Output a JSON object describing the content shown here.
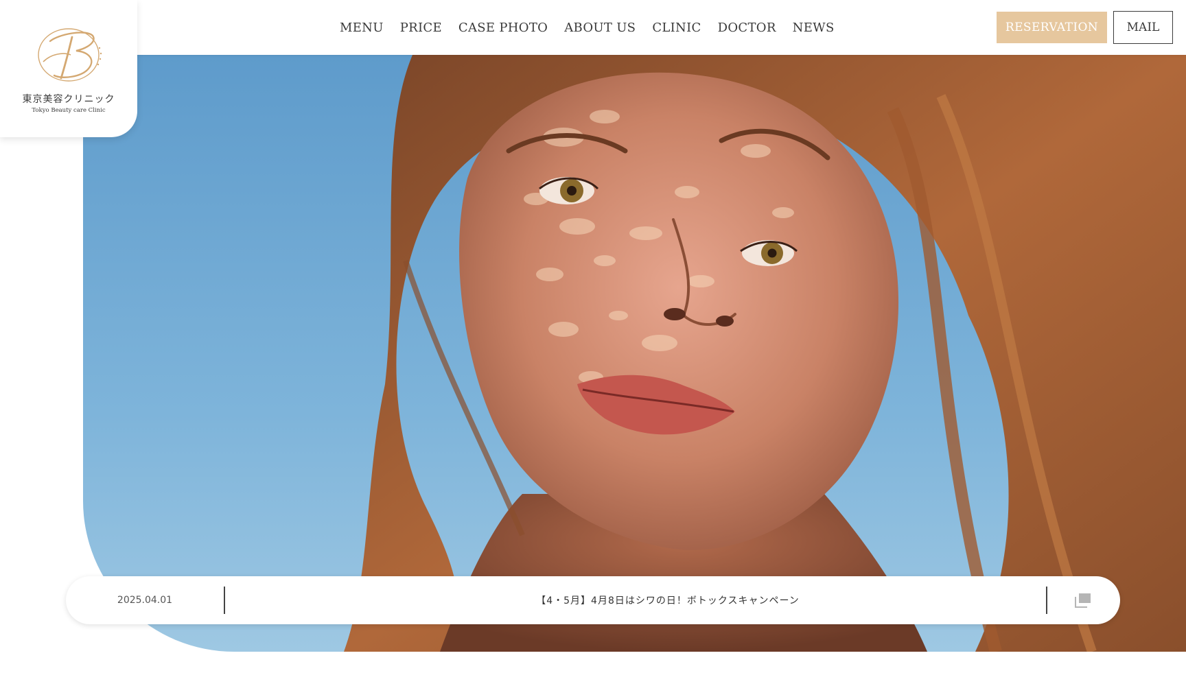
{
  "header": {
    "logo": {
      "name_jp": "東京美容クリニック",
      "name_en": "Tokyo Beauty care Clinic"
    },
    "nav": [
      {
        "label": "MENU"
      },
      {
        "label": "PRICE"
      },
      {
        "label": "CASE PHOTO"
      },
      {
        "label": "ABOUT US"
      },
      {
        "label": "CLINIC"
      },
      {
        "label": "DOCTOR"
      },
      {
        "label": "NEWS"
      }
    ],
    "reservation_label": "RESERVATION",
    "mail_label": "MAIL"
  },
  "news": {
    "date": "2025.04.01",
    "title": "【4・5月】4月8日はシワの日！ボトックスキャンペーン",
    "icon": "copy-windows-icon"
  },
  "colors": {
    "accent": "#e6c79e",
    "logo_gold": "#d4a871",
    "text": "#3a3a3a",
    "sky": "#6aa4cf"
  }
}
